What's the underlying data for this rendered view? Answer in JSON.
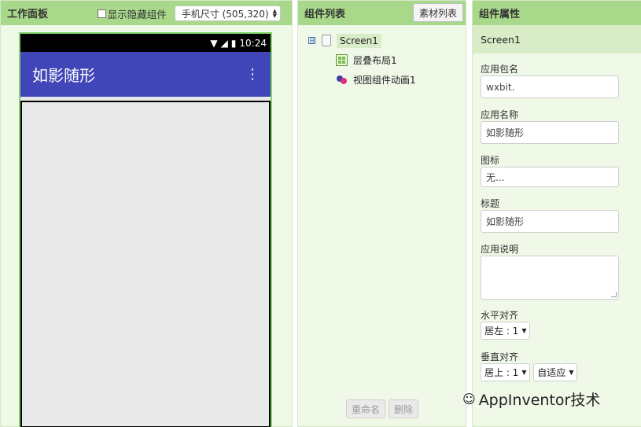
{
  "workspace": {
    "title": "工作面板",
    "show_hidden_label": "显示隐藏组件",
    "size_select": "手机尺寸 (505,320)",
    "phone": {
      "time": "10:24",
      "app_title": "如影随形",
      "menu_icon": "more-vert-icon",
      "colors": {
        "appbar": "#4046b8",
        "statusbar": "#000000",
        "canvas": "#e9e9e9"
      }
    }
  },
  "components": {
    "title": "组件列表",
    "assets_button": "素材列表",
    "collapse_symbol": "⊟",
    "screen": "Screen1",
    "children": [
      {
        "label": "层叠布局1",
        "icon": "layout-icon"
      },
      {
        "label": "视图组件动画1",
        "icon": "animation-icon"
      }
    ],
    "rename_button": "重命名",
    "delete_button": "删除"
  },
  "properties": {
    "title": "组件属性",
    "screen": "Screen1",
    "app_package_label": "应用包名",
    "app_package_value": "wxbit.",
    "app_name_label": "应用名称",
    "app_name_value": "如影随形",
    "icon_label": "图标",
    "icon_value": "无...",
    "title_label": "标题",
    "title_value": "如影随形",
    "description_label": "应用说明",
    "description_value": "",
    "h_align_label": "水平对齐",
    "h_align_value": "居左 : 1",
    "v_align_label": "垂直对齐",
    "v_align_value": "居上 : 1",
    "extra_select_value": "自适应"
  },
  "watermark": {
    "text": "AppInventor技术"
  }
}
